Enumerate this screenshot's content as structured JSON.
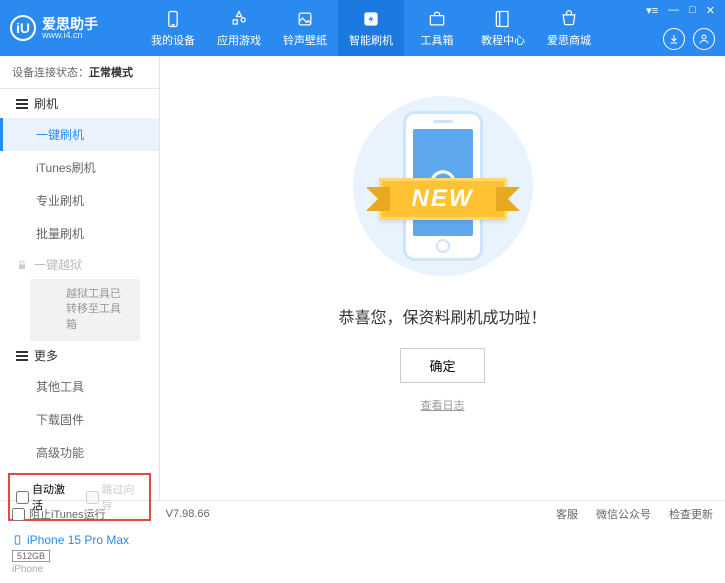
{
  "header": {
    "app_name": "爱思助手",
    "url": "www.i4.cn",
    "logo_letter": "iU",
    "nav": [
      {
        "label": "我的设备"
      },
      {
        "label": "应用游戏"
      },
      {
        "label": "铃声壁纸"
      },
      {
        "label": "智能刷机"
      },
      {
        "label": "工具箱"
      },
      {
        "label": "教程中心"
      },
      {
        "label": "爱思商城"
      }
    ]
  },
  "sidebar": {
    "status_label": "设备连接状态：",
    "status_value": "正常模式",
    "flash_header": "刷机",
    "flash_items": {
      "one_key": "一键刷机",
      "itunes": "iTunes刷机",
      "pro": "专业刷机",
      "batch": "批量刷机"
    },
    "jailbreak_header": "一键越狱",
    "jailbreak_note": "越狱工具已转移至工具箱",
    "more_header": "更多",
    "more_items": {
      "other_tools": "其他工具",
      "download_fw": "下载固件",
      "advanced": "高级功能"
    },
    "checkbox_auto_activate": "自动激活",
    "checkbox_skip_wizard": "跳过向导",
    "device": {
      "name": "iPhone 15 Pro Max",
      "storage": "512GB",
      "type": "iPhone"
    }
  },
  "main": {
    "ribbon_text": "NEW",
    "success_msg": "恭喜您，保资料刷机成功啦！",
    "ok_button": "确定",
    "view_log": "查看日志"
  },
  "footer": {
    "block_itunes": "阻止iTunes运行",
    "version": "V7.98.66",
    "links": {
      "service": "客服",
      "wechat": "微信公众号",
      "update": "检查更新"
    }
  }
}
